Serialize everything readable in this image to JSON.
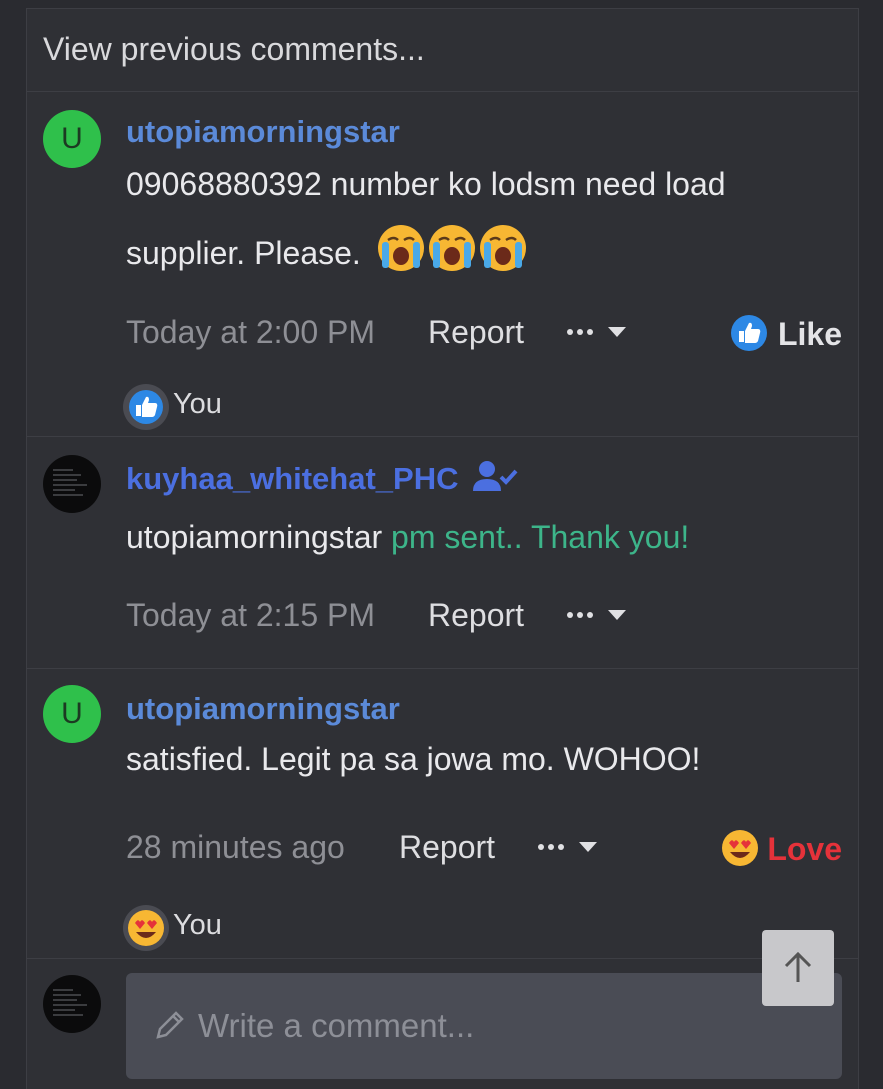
{
  "thread": {
    "view_previous": "View previous comments..."
  },
  "comments": [
    {
      "avatar_letter": "U",
      "username": "utopiamorningstar",
      "text_line1": "09068880392 number ko lodsm need load",
      "text_line2": "supplier. Please.",
      "time": "Today at 2:00 PM",
      "report_label": "Report",
      "reaction_label": "Like",
      "reacted_by": "You"
    },
    {
      "username": "kuyhaa_whitehat_PHC",
      "mention": "utopiamorningstar",
      "text": "pm sent.. Thank you!",
      "time": "Today at 2:15 PM",
      "report_label": "Report"
    },
    {
      "avatar_letter": "U",
      "username": "utopiamorningstar",
      "text": "satisfied. Legit pa sa jowa mo. WOHOO!",
      "time": "28 minutes ago",
      "report_label": "Report",
      "reaction_label": "Love",
      "reacted_by": "You"
    }
  ],
  "composer": {
    "placeholder": "Write a comment..."
  },
  "colors": {
    "username": "#5b8ad9",
    "mention_text": "#3db58a",
    "love": "#e5323a",
    "like_blue": "#2d88e5"
  }
}
